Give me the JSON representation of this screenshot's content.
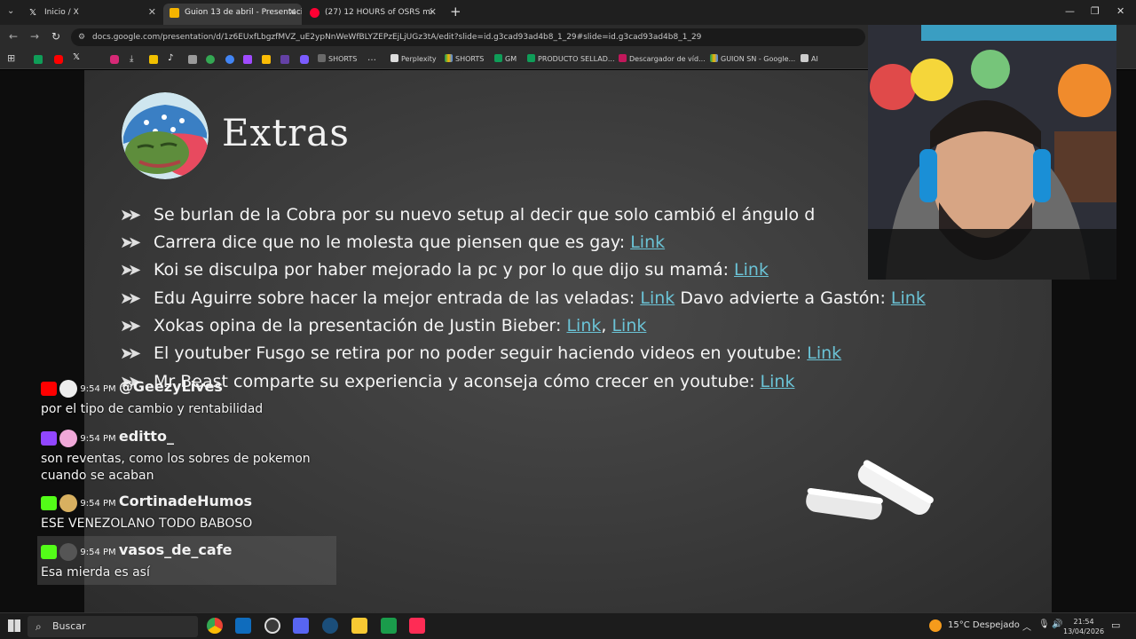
{
  "browser": {
    "tabs": [
      {
        "label": "Inicio / X",
        "active": false
      },
      {
        "label": "Guion 13 de abril - Presentación",
        "active": true
      },
      {
        "label": "(27) 12 HOURS of OSRS mi",
        "active": false
      }
    ],
    "url": "docs.google.com/presentation/d/1z6EUxfLbgzfMVZ_uE2ypNnWeWfBLYZEPzEjLjUGz3tA/edit?slide=id.g3cad93ad4b8_1_29#slide=id.g3cad93ad4b8_1_29",
    "bookmarks": [
      {
        "label": "SHORTS",
        "icon": "shorts-icon"
      },
      {
        "label": "Perplexity",
        "icon": "perplexity-icon"
      },
      {
        "label": "SHORTS",
        "icon": "drive-icon"
      },
      {
        "label": "GM",
        "icon": "sheets-icon"
      },
      {
        "label": "PRODUCTO SELLAD...",
        "icon": "sheets-icon"
      },
      {
        "label": "Descargador de víd...",
        "icon": "download-icon"
      },
      {
        "label": "GUION SN - Google...",
        "icon": "drive-icon"
      },
      {
        "label": "AI",
        "icon": "ai-icon"
      }
    ]
  },
  "slide": {
    "title": "Extras",
    "items": [
      {
        "text": "Se burlan de la Cobra por su nuevo setup al decir que solo cambió el ángulo d",
        "links": []
      },
      {
        "text": "Carrera dice que no le molesta que piensen que es gay: ",
        "links": [
          "Link"
        ]
      },
      {
        "text": "Koi se disculpa por haber mejorado la pc y por lo que dijo su mamá: ",
        "links": [
          "Link"
        ]
      },
      {
        "text": "Edu Aguirre sobre hacer la mejor entrada de las veladas: ",
        "links": [
          "Link"
        ],
        "text2": " Davo advierte a Gastón: ",
        "links2": [
          "Link"
        ]
      },
      {
        "text": "Xokas opina de la presentación de Justin Bieber: ",
        "links": [
          "Link",
          "Link"
        ]
      },
      {
        "text": "El youtuber Fusgo se retira por no poder seguir haciendo videos en youtube: ",
        "links": [
          "Link"
        ]
      },
      {
        "text": "Mr Beast comparte su experiencia y aconseja cómo crecer en youtube: ",
        "links": [
          "Link"
        ]
      }
    ]
  },
  "chat": [
    {
      "platform": "youtube",
      "time": "9:54 PM",
      "user": "@GeezyLives",
      "message": "por el tipo de cambio y rentabilidad"
    },
    {
      "platform": "twitch",
      "time": "9:54 PM",
      "user": "editto_",
      "message": "son reventas, como los sobres de pokemon",
      "message2": "cuando se acaban"
    },
    {
      "platform": "kick",
      "time": "9:54 PM",
      "user": "CortinadeHumos",
      "message": "ESE VENEZOLANO TODO BABOSO"
    },
    {
      "platform": "kick",
      "time": "9:54 PM",
      "user": "vasos_de_cafe",
      "message": "Esa mierda es así"
    }
  ],
  "taskbar": {
    "search_placeholder": "Buscar",
    "weather": "15°C  Despejado",
    "time": "21:54",
    "date": "13/04/2026"
  },
  "colors": {
    "link": "#6bc3d6",
    "youtube": "#ff0000",
    "twitch": "#9146ff",
    "kick": "#53fc18"
  }
}
